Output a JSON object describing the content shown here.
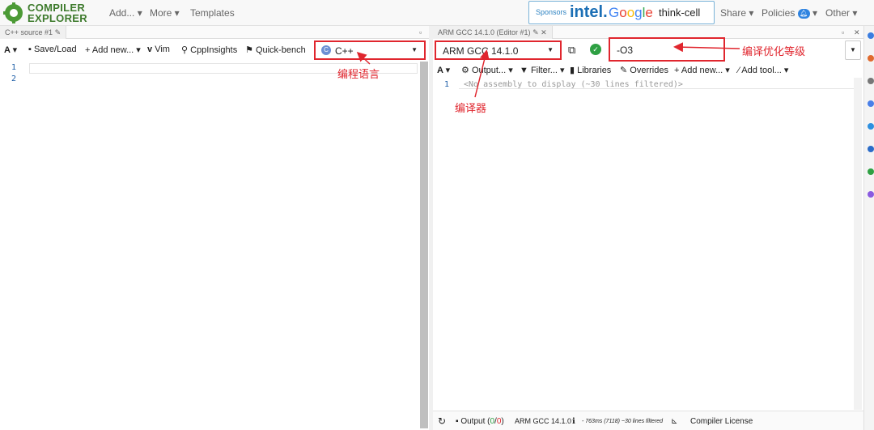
{
  "app": {
    "logo_line1": "COMPILER",
    "logo_line2": "EXPLORER",
    "nav": {
      "add": "Add...",
      "more": "More",
      "templates": "Templates"
    },
    "sponsors": {
      "label": "Sponsors",
      "intel": "intel.",
      "google": "Google",
      "thinkcell": "think-cell"
    },
    "right_nav": {
      "share": "Share",
      "policies": "Policies",
      "other": "Other"
    }
  },
  "source_pane": {
    "tab_title": "C++ source #1",
    "toolbar": {
      "font_label": "A",
      "save_load": "Save/Load",
      "add_new": "+ Add new...",
      "vim": "Vim",
      "cppinsights": "CppInsights",
      "quick_bench": "Quick-bench"
    },
    "language": "C++",
    "line_numbers": [
      "1",
      "2"
    ]
  },
  "compiler_pane": {
    "tab_title": "ARM GCC 14.1.0 (Editor #1)",
    "compiler": "ARM GCC 14.1.0",
    "options_value": "-O3",
    "toolbar2": {
      "font_label": "A",
      "output": "Output...",
      "filter": "Filter...",
      "libraries": "Libraries",
      "overrides": "Overrides",
      "add_new": "+ Add new...",
      "add_tool": "Add tool..."
    },
    "asm_line_number": "1",
    "asm_message": "<No assembly to display (~30 lines filtered)>",
    "status": {
      "output_label": "Output (",
      "output_ok": "0",
      "output_sep": "/",
      "output_err": "0",
      "output_close": ")",
      "compiler": "ARM GCC 14.1.0",
      "timing": "- 763ms (7118) ~30 lines filtered",
      "license": "Compiler License"
    }
  },
  "annotations": {
    "language": "编程语言",
    "compiler": "编译器",
    "optimization": "编译优化等级"
  },
  "colors": {
    "annotation_red": "#e0262e",
    "logo_green": "#3d7a2c",
    "link_blue": "#2060a8"
  }
}
